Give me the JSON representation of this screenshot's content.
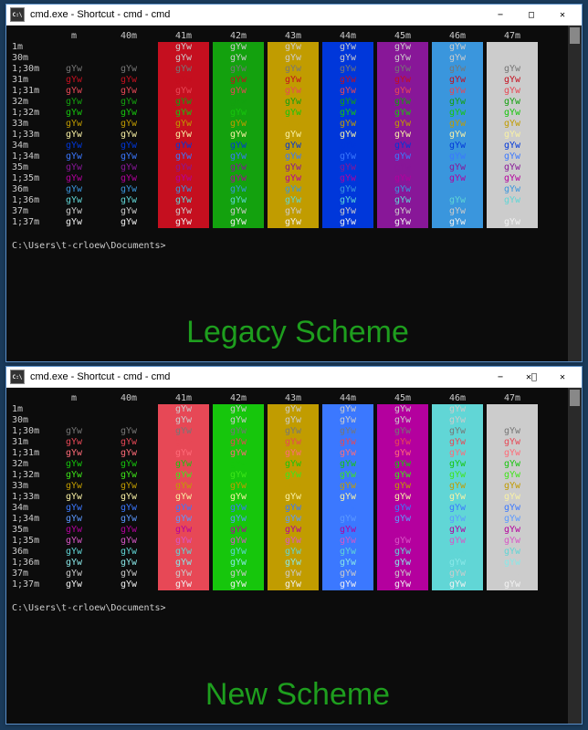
{
  "window_title": "cmd.exe - Shortcut - cmd - cmd",
  "prompt_text": "C:\\Users\\t-crloew\\Documents>",
  "sample_text": "gYw",
  "overlay_top": "Legacy Scheme",
  "overlay_bottom": "New Scheme",
  "ansi_background_headers": [
    "m",
    "40m",
    "41m",
    "42m",
    "43m",
    "44m",
    "45m",
    "46m",
    "47m"
  ],
  "ansi_row_codes": [
    "1m",
    "30m",
    "1;30m",
    "31m",
    "1;31m",
    "32m",
    "1;32m",
    "33m",
    "1;33m",
    "34m",
    "1;34m",
    "35m",
    "1;35m",
    "36m",
    "1;36m",
    "37m",
    "1;37m"
  ],
  "palettes": {
    "legacy": {
      "bg": [
        "#0c0c0c",
        "#0c0c0c",
        "#c50f1f",
        "#13a10e",
        "#c19c00",
        "#0037da",
        "#881798",
        "#3a96dd",
        "#cccccc"
      ],
      "fg": [
        "#cccccc",
        "#cccccc",
        "#767676",
        "#c50f1f",
        "#e74856",
        "#13a10e",
        "#16c60c",
        "#c19c00",
        "#f9f1a5",
        "#0037da",
        "#3b78ff",
        "#881798",
        "#b4009e",
        "#3a96dd",
        "#61d6d6",
        "#cccccc",
        "#f2f2f2"
      ]
    },
    "new": {
      "bg": [
        "#0c0c0c",
        "#0c0c0c",
        "#e74856",
        "#16c60c",
        "#c19c00",
        "#3b78ff",
        "#b4009e",
        "#61d6d6",
        "#cccccc"
      ],
      "fg": [
        "#cccccc",
        "#cccccc",
        "#767676",
        "#e74856",
        "#ff6b78",
        "#16c60c",
        "#3ee619",
        "#c19c00",
        "#f9f1a5",
        "#3b78ff",
        "#5c99ff",
        "#b4009e",
        "#d857c7",
        "#61d6d6",
        "#8ae8e8",
        "#cccccc",
        "#f2f2f2"
      ]
    }
  }
}
